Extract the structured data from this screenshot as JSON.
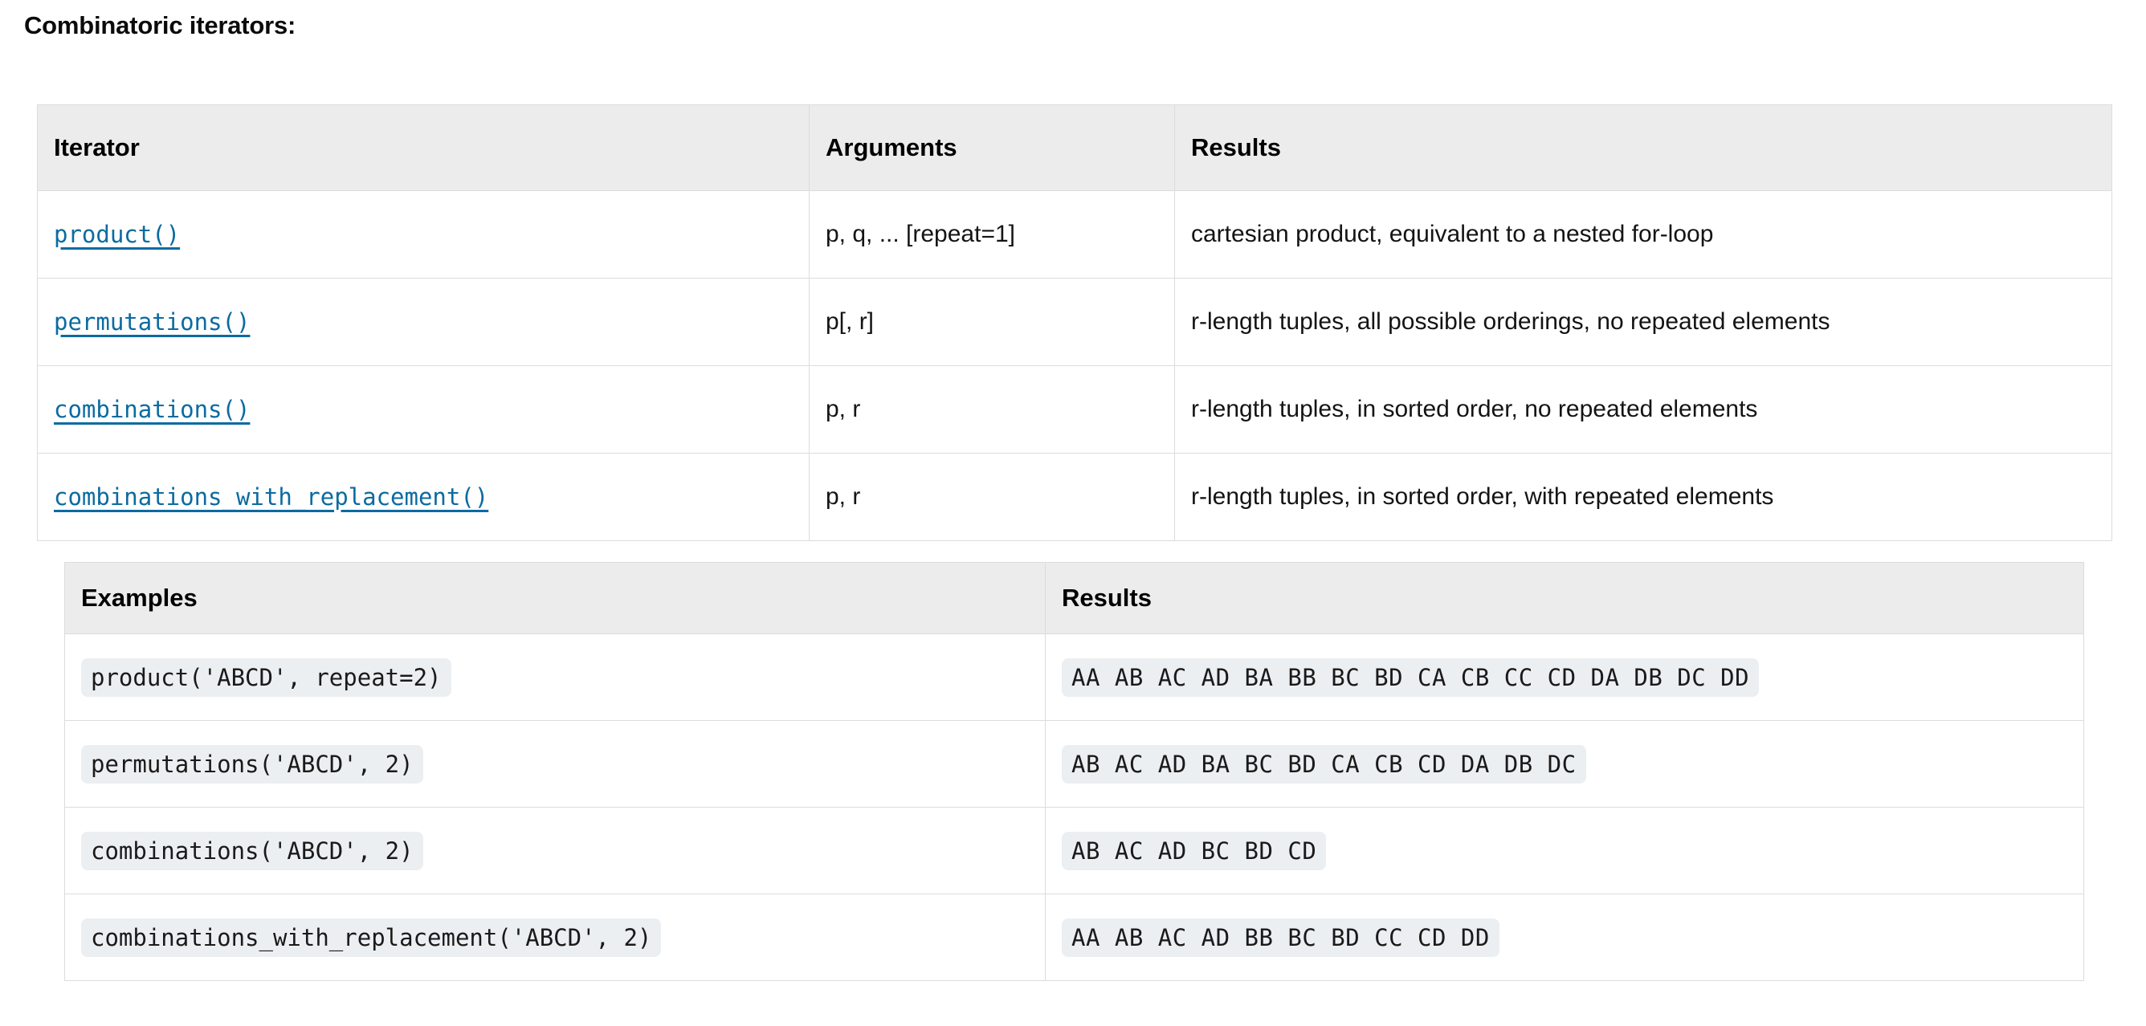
{
  "page": {
    "section_title": "Combinatoric iterators:"
  },
  "iterators_table": {
    "name": "combinatoric-iterators-table",
    "headers": [
      "Iterator",
      "Arguments",
      "Results"
    ],
    "rows": [
      {
        "iterator": "product()",
        "arguments": "p, q, ... [repeat=1]",
        "results": "cartesian product, equivalent to a nested for-loop"
      },
      {
        "iterator": "permutations()",
        "arguments": "p[, r]",
        "results": "r-length tuples, all possible orderings, no repeated elements"
      },
      {
        "iterator": "combinations()",
        "arguments": "p, r",
        "results": "r-length tuples, in sorted order, no repeated elements"
      },
      {
        "iterator": "combinations_with_replacement()",
        "arguments": "p, r",
        "results": "r-length tuples, in sorted order, with repeated elements"
      }
    ]
  },
  "examples_table": {
    "name": "combinatoric-examples-table",
    "headers": [
      "Examples",
      "Results"
    ],
    "rows": [
      {
        "example": "product('ABCD', repeat=2)",
        "results": "AA AB AC AD BA BB BC BD CA CB CC CD DA DB DC DD"
      },
      {
        "example": "permutations('ABCD', 2)",
        "results": "AB AC AD BA BC BD CA CB CD DA DB DC"
      },
      {
        "example": "combinations('ABCD', 2)",
        "results": "AB AC AD BC BD CD"
      },
      {
        "example": "combinations_with_replacement('ABCD', 2)",
        "results": "AA AB AC AD BB BC BD CC CD DD"
      }
    ]
  },
  "colors": {
    "link": "#0b6ba1",
    "header_background": "#ececec",
    "border": "#dcdcdc",
    "code_background": "#eceff1",
    "text": "#141414"
  }
}
